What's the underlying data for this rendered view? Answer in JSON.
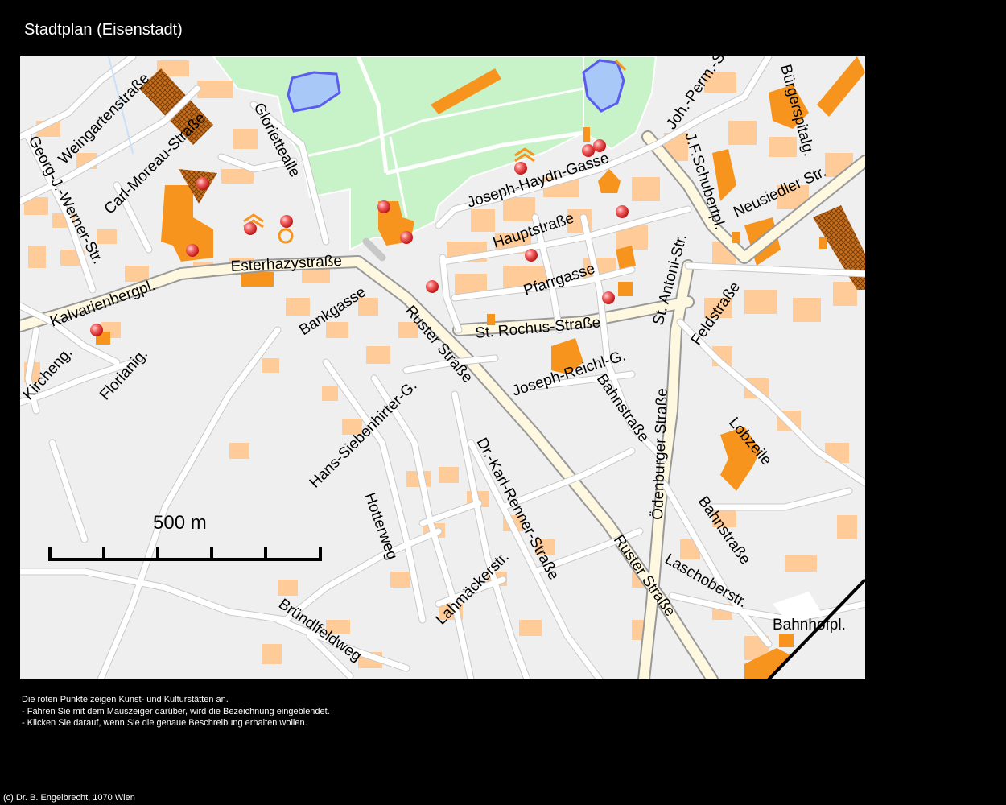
{
  "title": "Stadtplan (Eisenstadt)",
  "map": {
    "scale_label": "500 m",
    "streets": [
      {
        "id": "weingartenstrasse",
        "label": "Weingartenstraße"
      },
      {
        "id": "carl-moreau",
        "label": "Carl-Moreau-Straße"
      },
      {
        "id": "gloriette",
        "label": "Gloriettealle"
      },
      {
        "id": "georg-werner",
        "label": "Georg-J.-Werner-Str."
      },
      {
        "id": "esterhazy",
        "label": "Esterhazystraße"
      },
      {
        "id": "kalvarienberg",
        "label": "Kalvarienbergpl."
      },
      {
        "id": "bankgasse",
        "label": "Bankgasse"
      },
      {
        "id": "kircheng",
        "label": "Kircheng."
      },
      {
        "id": "florianig",
        "label": "Florianig."
      },
      {
        "id": "joseph-haydn",
        "label": "Joseph-Haydn-Gasse"
      },
      {
        "id": "hauptstrasse",
        "label": "Hauptstraße"
      },
      {
        "id": "pfarrgasse",
        "label": "Pfarrgasse"
      },
      {
        "id": "st-rochus",
        "label": "St. Rochus-Straße"
      },
      {
        "id": "ruster-1",
        "label": "Ruster Straße"
      },
      {
        "id": "joseph-reichl",
        "label": "Joseph-Reichl-G."
      },
      {
        "id": "bahnstrasse-1",
        "label": "Bahnstraße"
      },
      {
        "id": "hans-siebenhirter",
        "label": "Hans-Siebenhirter-G."
      },
      {
        "id": "dr-karl-renner",
        "label": "Dr.-Karl-Renner-Straße"
      },
      {
        "id": "hotterweg",
        "label": "Hotterweg"
      },
      {
        "id": "lahmaecker",
        "label": "Lahmäckerstr."
      },
      {
        "id": "bruendlfeld",
        "label": "Bründlfeldweg"
      },
      {
        "id": "ruster-2",
        "label": "Ruster Straße"
      },
      {
        "id": "oedenburger",
        "label": "Ödenburger Straße"
      },
      {
        "id": "bahnstrasse-2",
        "label": "Bahnstraße"
      },
      {
        "id": "laschober",
        "label": "Laschoberstr."
      },
      {
        "id": "bahnhofpl",
        "label": "Bahnhofpl."
      },
      {
        "id": "lobzeile",
        "label": "Lobzeile"
      },
      {
        "id": "feldstrasse",
        "label": "Feldstraße"
      },
      {
        "id": "st-antoni",
        "label": "St. Antoni-Str."
      },
      {
        "id": "schubertpl",
        "label": "J.F.Schubertpl."
      },
      {
        "id": "neusiedler",
        "label": "Neusiedler Str."
      },
      {
        "id": "joh-perm",
        "label": "Joh.-Perm.-Str."
      },
      {
        "id": "buergerspital",
        "label": "Bürgerspitalg."
      }
    ]
  },
  "info": {
    "line1": "Die roten Punkte zeigen Kunst- und Kulturstätten an.",
    "line2": "- Fahren Sie mit dem Mauszeiger darüber, wird die Bezeichnung eingeblendet.",
    "line3": "- Klicken Sie darauf, wenn Sie die genaue Beschreibung erhalten wollen."
  },
  "copyright": "(c) Dr. B. Engelbrecht, 1070 Wien",
  "colors": {
    "background": "#000000",
    "map_bg": "#efefef",
    "park": "#c8f3c8",
    "building": "#ffcc99",
    "public_building": "#f7941d",
    "water": "#a8c8f8",
    "road": "#ffffff",
    "poi": "#e02020"
  }
}
